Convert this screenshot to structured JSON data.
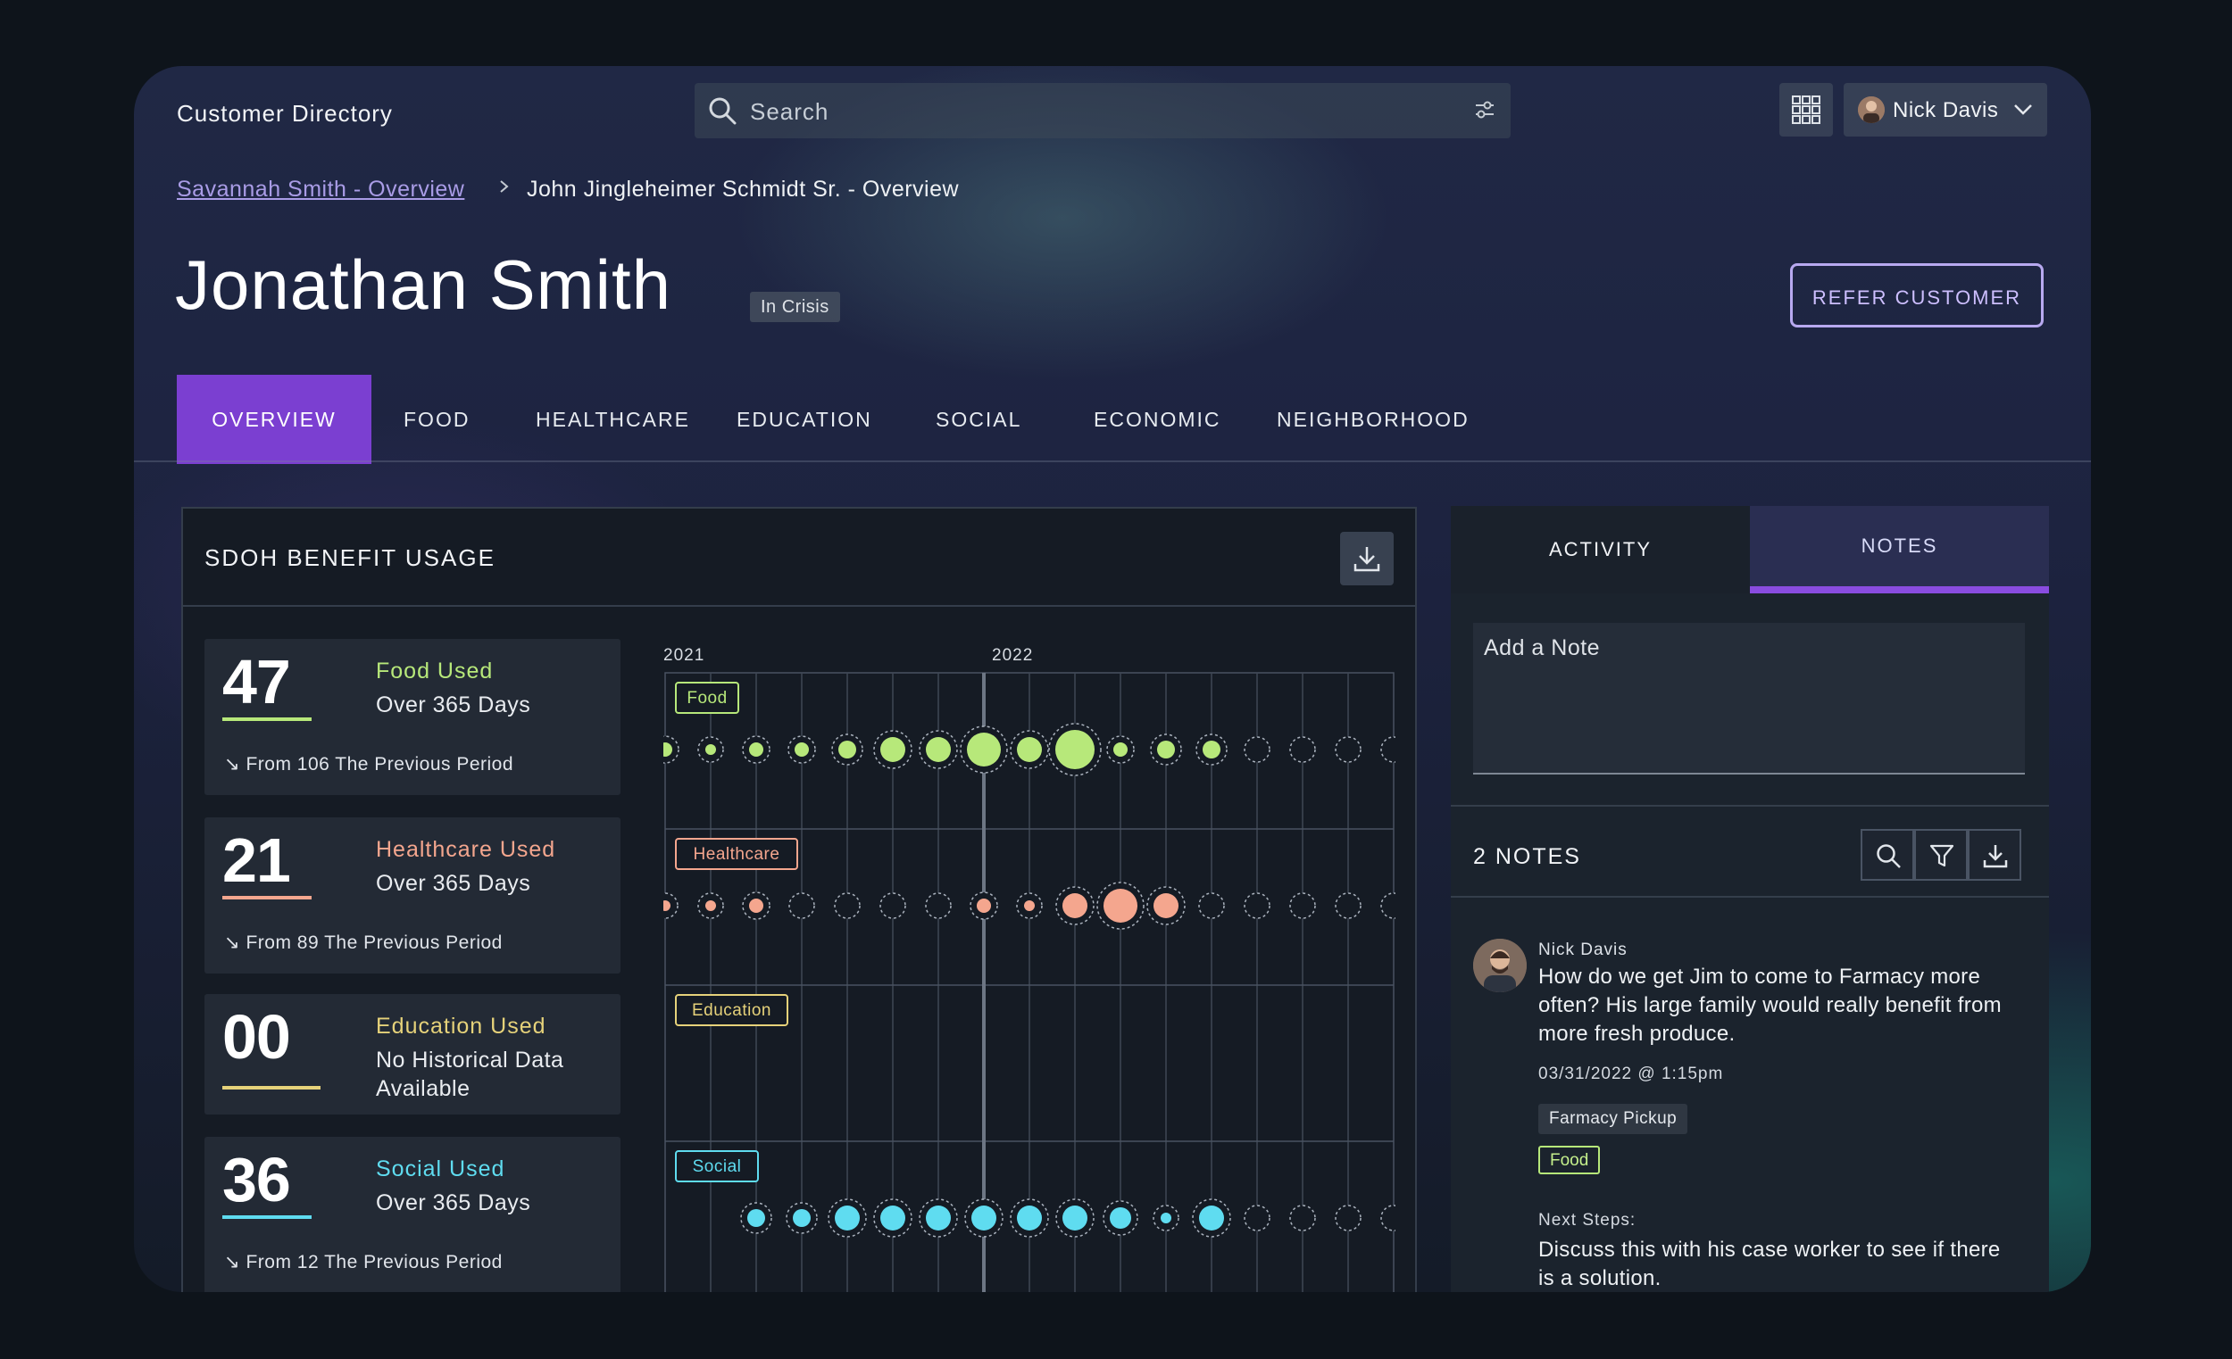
{
  "app": {
    "title": "Customer Directory"
  },
  "search": {
    "placeholder": "Search"
  },
  "user": {
    "name": "Nick Davis"
  },
  "breadcrumb": {
    "items": [
      "Savannah Smith - Overview",
      "John Jingleheimer Schmidt Sr. - Overview"
    ]
  },
  "profile": {
    "name": "Jonathan Smith",
    "status": "In Crisis",
    "refer_label": "REFER CUSTOMER"
  },
  "tabs": [
    "OVERVIEW",
    "FOOD",
    "HEALTHCARE",
    "EDUCATION",
    "SOCIAL",
    "ECONOMIC",
    "NEIGHBORHOOD"
  ],
  "panel": {
    "title": "SDOH BENEFIT USAGE"
  },
  "stats": [
    {
      "value": "47",
      "label": "Food Used",
      "sub": "Over 365 Days",
      "from": "From 106 The Previous Period",
      "color": "#b7e87a"
    },
    {
      "value": "21",
      "label": "Healthcare Used",
      "sub": "Over 365 Days",
      "from": "From 89 The Previous Period",
      "color": "#f4a68e"
    },
    {
      "value": "00",
      "label": "Education Used",
      "sub": "No Historical Data Available",
      "from": "",
      "color": "#e6d27a"
    },
    {
      "value": "36",
      "label": "Social Used",
      "sub": "Over 365 Days",
      "from": "From 12 The Previous Period",
      "color": "#5fdcf0"
    }
  ],
  "chart_data": {
    "type": "scatter",
    "x_labels": [
      "2021",
      "2022"
    ],
    "series": [
      {
        "name": "Food",
        "color": "#b7e87a",
        "sizes": [
          2,
          1,
          2,
          2,
          3,
          5,
          5,
          7,
          5,
          8,
          2,
          3,
          3,
          0,
          0,
          0,
          0
        ]
      },
      {
        "name": "Healthcare",
        "color": "#f4a68e",
        "sizes": [
          1,
          1,
          2,
          0,
          0,
          0,
          0,
          2,
          1,
          5,
          7,
          5,
          0,
          0,
          0,
          0,
          0
        ]
      },
      {
        "name": "Education",
        "color": "#e6d27a",
        "sizes": [
          0,
          0,
          0,
          0,
          0,
          0,
          0,
          0,
          0,
          0,
          0,
          0,
          0,
          0,
          0,
          0,
          0
        ]
      },
      {
        "name": "Social",
        "color": "#5fdcf0",
        "sizes": [
          null,
          null,
          3,
          3,
          5,
          5,
          5,
          5,
          5,
          5,
          4,
          1,
          5,
          0,
          0,
          0,
          0
        ]
      }
    ]
  },
  "side": {
    "tabs": [
      "ACTIVITY",
      "NOTES"
    ],
    "note_placeholder": "Add a Note",
    "notes_count": "2 NOTES"
  },
  "note": {
    "author": "Nick Davis",
    "text": "How do we get Jim to come to Farmacy more often? His large family would really benefit from more fresh produce.",
    "time": "03/31/2022 @ 1:15pm",
    "tags": [
      "Farmacy Pickup",
      "Food"
    ],
    "next_label": "Next Steps:",
    "next_text": "Discuss this with his case worker to see if there is a solution."
  },
  "colors": {
    "accent": "#7b3fd1",
    "food": "#b7e87a",
    "healthcare": "#f4a68e",
    "education": "#e6d27a",
    "social": "#5fdcf0"
  }
}
